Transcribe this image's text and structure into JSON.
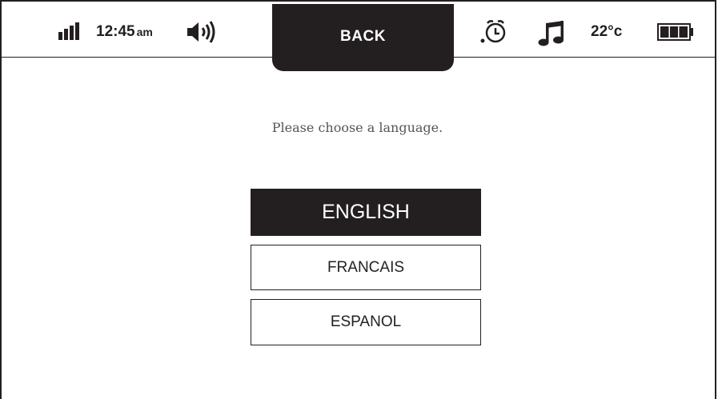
{
  "status_bar": {
    "time": "12:45",
    "ampm": "am",
    "temperature": "22°c",
    "icons": [
      "signal-icon",
      "volume-icon",
      "alarm-clock-icon",
      "music-note-icon",
      "battery-icon"
    ],
    "battery_level": 1.0
  },
  "nav": {
    "back_label": "BACK"
  },
  "main": {
    "prompt": "Please choose a language.",
    "languages": [
      {
        "label": "ENGLISH",
        "selected": true
      },
      {
        "label": "FRANCAIS",
        "selected": false
      },
      {
        "label": "ESPANOL",
        "selected": false
      }
    ]
  },
  "colors": {
    "ink": "#231f20",
    "background": "#ffffff",
    "prompt_text": "#555555"
  }
}
